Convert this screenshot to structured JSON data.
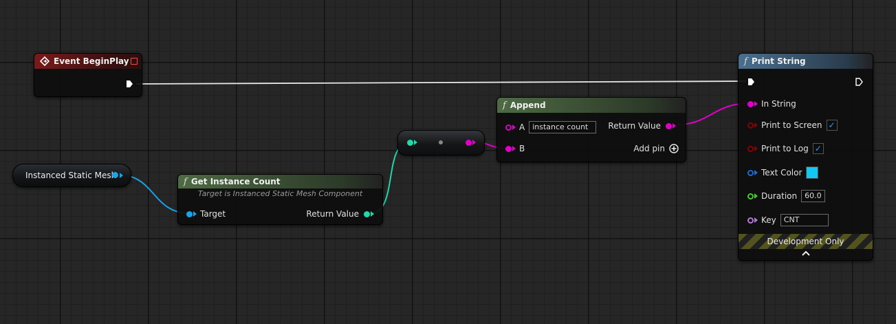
{
  "colors": {
    "exec": "#ffffff",
    "string": "#e000c8",
    "integer": "#20d8a8",
    "object": "#1aa3e6",
    "boolean": "#8a0000",
    "struct": "#1a6ad9",
    "float": "#48c832",
    "name": "#b47ad8"
  },
  "event_begin_play": {
    "title": "Event BeginPlay",
    "icon": "event-diamond-icon"
  },
  "instanced_static_mesh": {
    "label": "Instanced Static Mesh"
  },
  "get_instance_count": {
    "title": "Get Instance Count",
    "subtitle": "Target is Instanced Static Mesh Component",
    "target_label": "Target",
    "return_label": "Return Value"
  },
  "append": {
    "title": "Append",
    "a_label": "A",
    "a_value": "instance count",
    "b_label": "B",
    "return_label": "Return Value",
    "add_pin_label": "Add pin"
  },
  "print_string": {
    "title": "Print String",
    "in_string_label": "In String",
    "print_to_screen_label": "Print to Screen",
    "print_to_screen_checked": true,
    "print_to_log_label": "Print to Log",
    "print_to_log_checked": true,
    "text_color_label": "Text Color",
    "text_color_value": "#12c8f0",
    "duration_label": "Duration",
    "duration_value": "60.0",
    "key_label": "Key",
    "key_value": "CNT",
    "dev_only_label": "Development Only"
  }
}
